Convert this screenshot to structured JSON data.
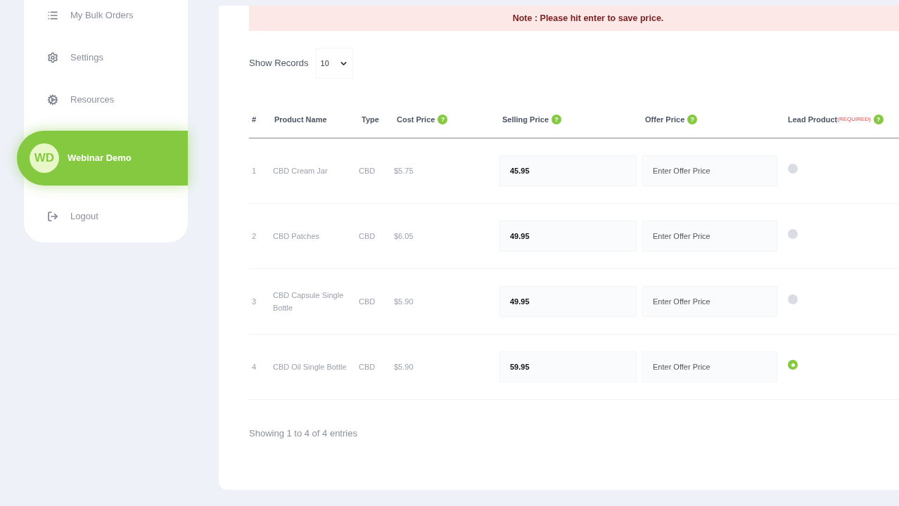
{
  "sidebar": {
    "items": [
      {
        "label": "My Bulk Orders",
        "kind": "link",
        "selected": false
      },
      {
        "label": "Settings",
        "kind": "link",
        "selected": false
      },
      {
        "label": "Resources",
        "kind": "link",
        "selected": false
      },
      {
        "label": "Webinar Demo",
        "kind": "profile",
        "initials": "WD",
        "selected": true
      },
      {
        "label": "Logout",
        "kind": "link",
        "selected": false
      }
    ]
  },
  "note": "Note : Please hit enter to save price.",
  "show_records": {
    "label": "Show Records",
    "value": "10"
  },
  "table": {
    "columns": [
      {
        "label": "#"
      },
      {
        "label": "Product Name"
      },
      {
        "label": "Type"
      },
      {
        "label": "Cost Price",
        "help": "?"
      },
      {
        "label": "Selling Price",
        "help": "?"
      },
      {
        "label": "Offer Price",
        "help": "?"
      },
      {
        "label": "Lead Product",
        "help": "?"
      }
    ],
    "required_label": "(REQUIRED)",
    "rows": [
      {
        "index": "1",
        "name": "CBD Cream Jar",
        "type": "CBD",
        "cost": "$5.75",
        "selling": "45.95",
        "offer_placeholder": "Enter Offer Price",
        "selected": false
      },
      {
        "index": "2",
        "name": "CBD Patches",
        "type": "CBD",
        "cost": "$6.05",
        "selling": "49.95",
        "offer_placeholder": "Enter Offer Price",
        "selected": false
      },
      {
        "index": "3",
        "name": "CBD Capsule Single Bottle",
        "type": "CBD",
        "cost": "$5.90",
        "selling": "49.95",
        "offer_placeholder": "Enter Offer Price",
        "selected": false
      },
      {
        "index": "4",
        "name": "CBD Oil Single Bottle",
        "type": "CBD",
        "cost": "$5.90",
        "selling": "59.95",
        "offer_placeholder": "Enter Offer Price",
        "selected": true
      }
    ]
  },
  "footer": "Showing 1 to 4 of 4 entries"
}
